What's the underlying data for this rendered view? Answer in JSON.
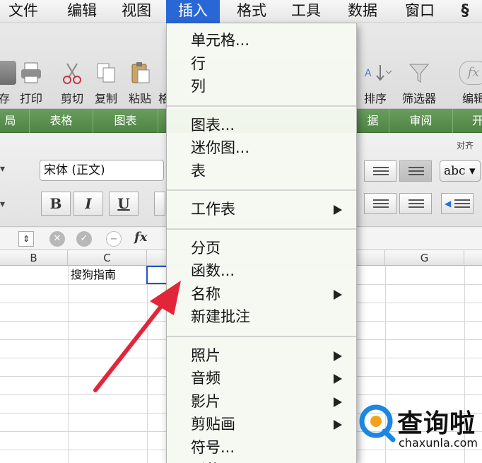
{
  "menubar": {
    "items": [
      "文件",
      "编辑",
      "视图",
      "插入",
      "格式",
      "工具",
      "数据",
      "窗口"
    ],
    "active": "插入"
  },
  "toolbar": {
    "buttons": [
      "存",
      "打印",
      "剪切",
      "复制",
      "粘贴",
      "格",
      "排序",
      "筛选器",
      "编辑"
    ]
  },
  "ribbon_tabs": [
    "局",
    "表格",
    "图表",
    "据",
    "审阅",
    "开"
  ],
  "format": {
    "font_name": "宋体 (正文)",
    "bold": "B",
    "italic": "I",
    "underline": "U",
    "abc": "abc",
    "align_group_label": "对齐"
  },
  "formula_bar": {
    "fx_label": "fx"
  },
  "grid": {
    "columns": [
      "B",
      "C",
      "G"
    ],
    "cell_c1": "搜狗指南"
  },
  "insert_menu": {
    "groups": [
      [
        {
          "label": "单元格...",
          "submenu": false
        },
        {
          "label": "行",
          "submenu": false
        },
        {
          "label": "列",
          "submenu": false
        }
      ],
      [
        {
          "label": "图表...",
          "submenu": false
        },
        {
          "label": "迷你图...",
          "submenu": false
        },
        {
          "label": "表",
          "submenu": false
        }
      ],
      [
        {
          "label": "工作表",
          "submenu": true
        }
      ],
      [
        {
          "label": "分页",
          "submenu": false
        },
        {
          "label": "函数...",
          "submenu": false
        },
        {
          "label": "名称",
          "submenu": true
        },
        {
          "label": "新建批注",
          "submenu": false
        }
      ],
      [
        {
          "label": "照片",
          "submenu": true
        },
        {
          "label": "音频",
          "submenu": true
        },
        {
          "label": "影片",
          "submenu": true
        },
        {
          "label": "剪贴画",
          "submenu": true
        },
        {
          "label": "符号...",
          "submenu": false
        },
        {
          "label": "形状",
          "submenu": false
        }
      ]
    ]
  },
  "watermark": {
    "main": "查询啦",
    "sub": "chaxunla.com"
  },
  "colors": {
    "menu_highlight": "#2a67d6",
    "ribbon_green": "#5a9150",
    "arrow_red": "#e2263a",
    "selection_blue": "#1f55c9",
    "watermark_blue": "#1d86e0",
    "watermark_orange": "#f2a31b"
  }
}
